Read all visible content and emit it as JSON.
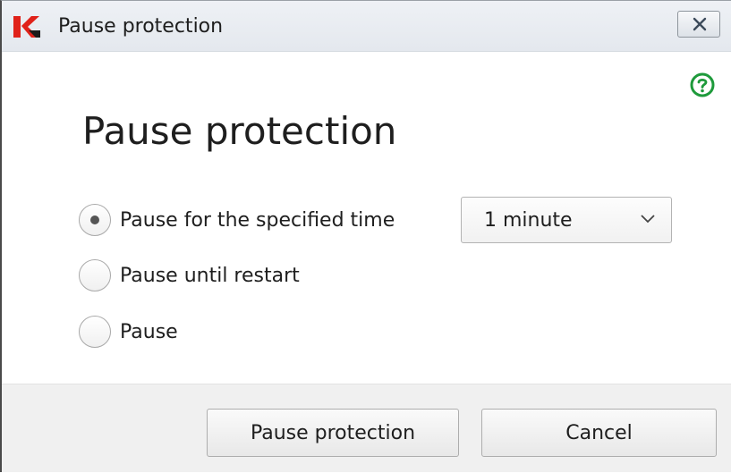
{
  "window": {
    "title": "Pause protection",
    "app_icon": "kaspersky-k-logo",
    "close_icon": "close-x-icon",
    "help_icon": "question-circle-icon",
    "colors": {
      "brand_red": "#e0221a",
      "help_green": "#1e9a3b"
    }
  },
  "main": {
    "heading": "Pause protection",
    "options": [
      {
        "label": "Pause for the specified time",
        "selected": true
      },
      {
        "label": "Pause until restart",
        "selected": false
      },
      {
        "label": "Pause",
        "selected": false
      }
    ],
    "duration_select": {
      "value": "1 minute",
      "icon": "chevron-down-icon"
    }
  },
  "footer": {
    "pause_button": "Pause protection",
    "cancel_button": "Cancel"
  }
}
